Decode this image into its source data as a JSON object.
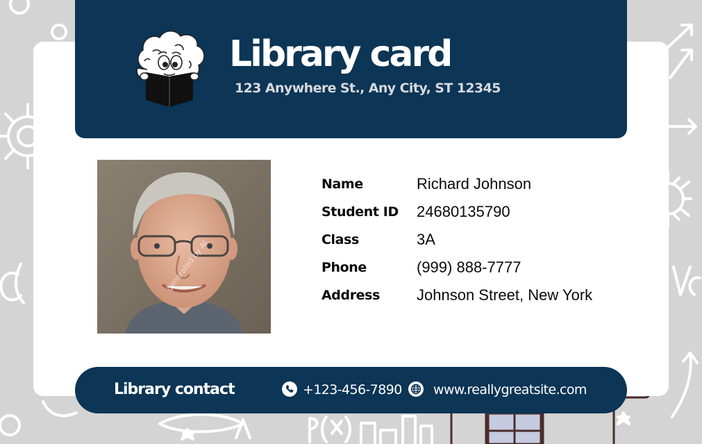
{
  "header": {
    "title": "Library card",
    "address": "123 Anywhere St., Any City, ST 12345",
    "logo_icon": "reading-brain-mascot-icon"
  },
  "photo": {
    "subject": "student-portrait",
    "watermark": "generated by AI"
  },
  "student": {
    "fields": [
      {
        "label": "Name",
        "value": "Richard Johnson"
      },
      {
        "label": "Student ID",
        "value": "24680135790"
      },
      {
        "label": "Class",
        "value": "3A"
      },
      {
        "label": "Phone",
        "value": "(999) 888-7777"
      },
      {
        "label": "Address",
        "value": "Johnson Street, New York"
      }
    ]
  },
  "footer": {
    "title": "Library contact",
    "phone": "+123-456-7890",
    "phone_icon": "phone-icon",
    "website": "www.reallygreatsite.com",
    "website_icon": "globe-icon"
  },
  "colors": {
    "navy": "#0c3556",
    "background": "#d4d4d4",
    "card": "#ffffff"
  }
}
